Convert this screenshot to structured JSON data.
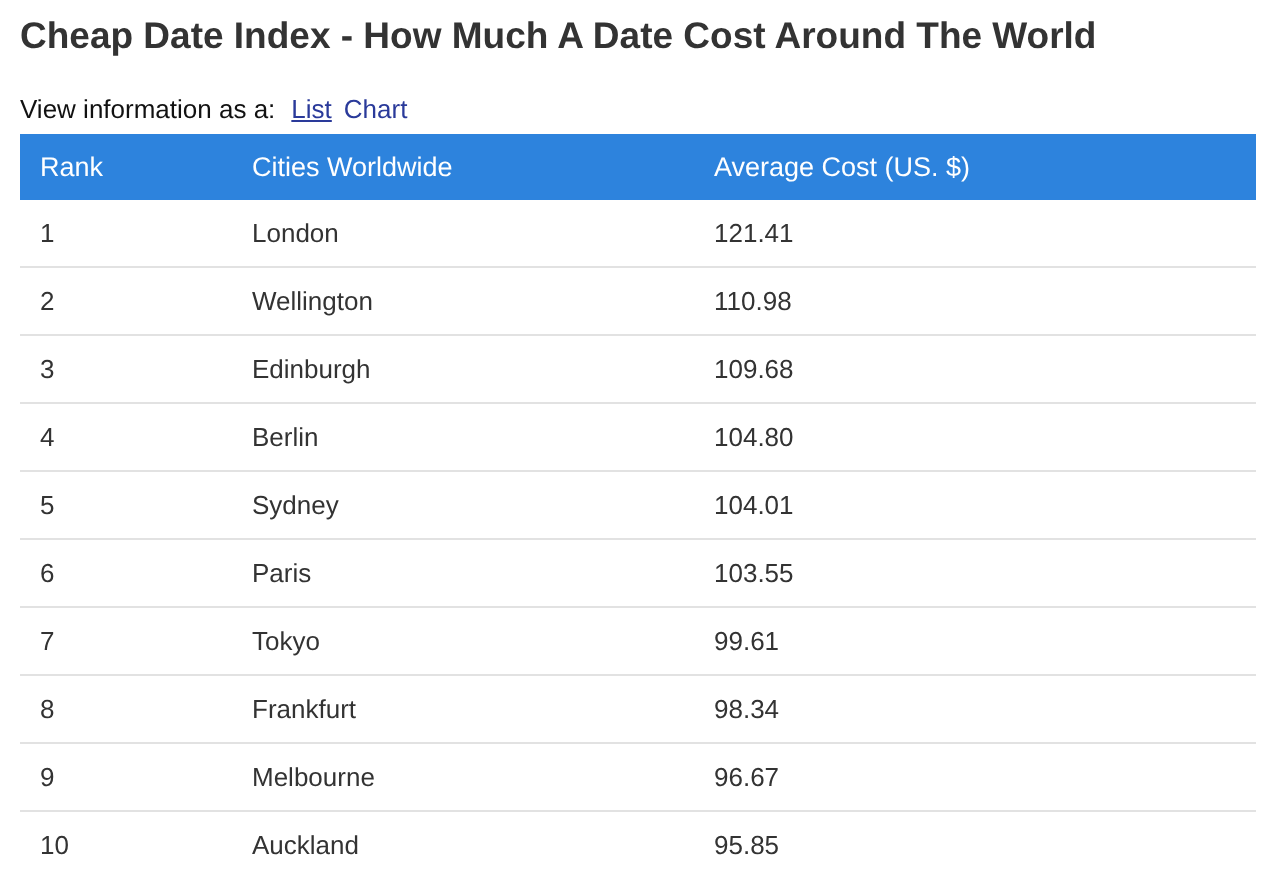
{
  "title": "Cheap Date Index - How Much A Date Cost Around The World",
  "view": {
    "label": "View information as a:",
    "options": [
      {
        "label": "List",
        "selected": true
      },
      {
        "label": "Chart",
        "selected": false
      }
    ]
  },
  "table": {
    "columns": [
      "Rank",
      "Cities Worldwide",
      "Average Cost (US. $)"
    ],
    "rows": [
      [
        "1",
        "London",
        "121.41"
      ],
      [
        "2",
        "Wellington",
        "110.98"
      ],
      [
        "3",
        "Edinburgh",
        "109.68"
      ],
      [
        "4",
        "Berlin",
        "104.80"
      ],
      [
        "5",
        "Sydney",
        "104.01"
      ],
      [
        "6",
        "Paris",
        "103.55"
      ],
      [
        "7",
        "Tokyo",
        "99.61"
      ],
      [
        "8",
        "Frankfurt",
        "98.34"
      ],
      [
        "9",
        "Melbourne",
        "96.67"
      ],
      [
        "10",
        "Auckland",
        "95.85"
      ]
    ]
  }
}
